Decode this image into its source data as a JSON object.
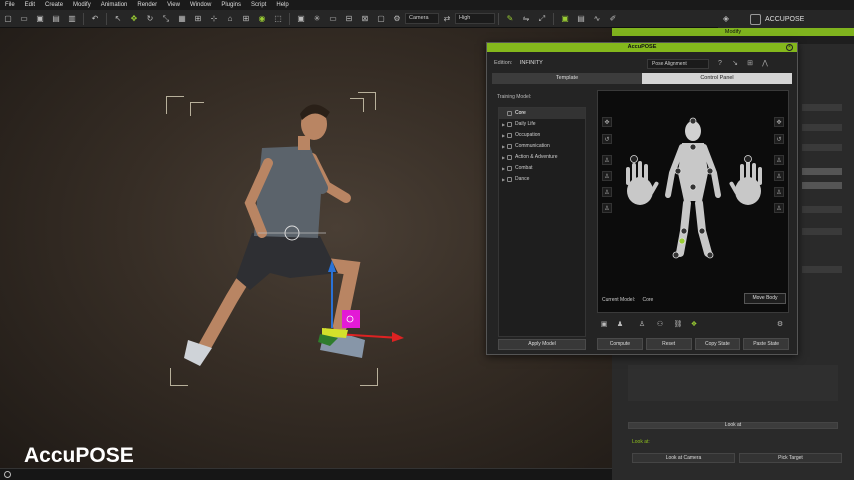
{
  "menubar": [
    "File",
    "Edit",
    "Create",
    "Modify",
    "Animation",
    "Render",
    "View",
    "Window",
    "Plugins",
    "Script",
    "Help"
  ],
  "toolbar": {
    "camera_select": "Camera",
    "quality_select": "High"
  },
  "brand": {
    "name": "ACCUPOSE"
  },
  "viewport": {
    "overlay_title": "AccuPOSE"
  },
  "right_panel": {
    "tab": "Modify",
    "look_at_header": "Look at",
    "look_at_label": "Look at:",
    "look_at_camera": "Look at Camera",
    "pick_target": "Pick Target"
  },
  "dialog": {
    "title": "AccuPOSE",
    "edition_label": "Edition:",
    "edition_value": "INFINITY",
    "pose_select": "Pose Alignment",
    "tabs": [
      "Template",
      "Control Panel"
    ],
    "active_tab": "Control Panel",
    "training_model_label": "Training Model:",
    "tree": [
      {
        "label": "Core",
        "selected": true
      },
      {
        "label": "Daily Life",
        "selected": false
      },
      {
        "label": "Occupation",
        "selected": false
      },
      {
        "label": "Communication",
        "selected": false
      },
      {
        "label": "Action & Adventure",
        "selected": false
      },
      {
        "label": "Combat",
        "selected": false
      },
      {
        "label": "Dance",
        "selected": false
      }
    ],
    "apply_model": "Apply Model",
    "current_model_label": "Current Model:",
    "current_model_value": "Core",
    "move_body": "Move Body",
    "actions": [
      "Compute",
      "Reset",
      "Copy State",
      "Paste State"
    ]
  },
  "colors": {
    "accent": "#84b81c",
    "gizmo_magenta": "#e31ad6"
  }
}
